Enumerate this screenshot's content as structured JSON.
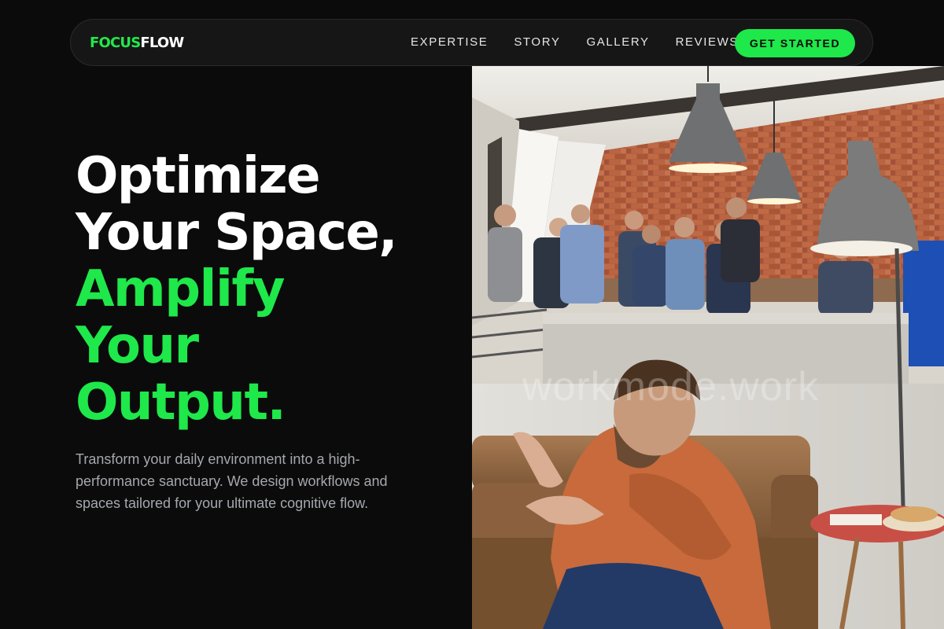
{
  "nav": {
    "logo_part1": "FOCUS",
    "logo_part2": "FLOW",
    "links": [
      "EXPERTISE",
      "STORY",
      "GALLERY",
      "REVIEWS"
    ],
    "cta_label": "GET STARTED"
  },
  "hero": {
    "headline_white_1": "Optimize",
    "headline_white_2": "Your Space,",
    "headline_green_1": "Amplify",
    "headline_green_2": "Your",
    "headline_green_3": "Output.",
    "subtext": "Transform your daily environment into a high-performance sanctuary. We design workflows and spaces tailored for your ultimate cognitive flow.",
    "image_watermark": "workmode.work"
  },
  "colors": {
    "background": "#0b0b0b",
    "accent": "#1fe84a",
    "nav_bg": "#161616",
    "subtext": "#a5a8ad"
  }
}
